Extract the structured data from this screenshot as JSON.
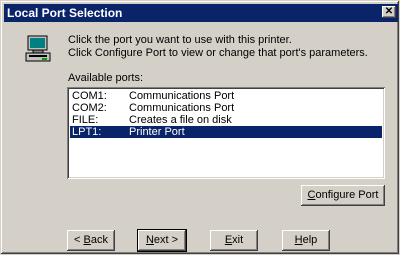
{
  "window": {
    "title": "Local Port Selection",
    "close_glyph": "✕"
  },
  "instructions": {
    "line1": "Click the port you want to use with this printer.",
    "line2": "Click Configure Port to view or change that port's parameters."
  },
  "ports_label": "Available ports:",
  "ports": [
    {
      "port": "COM1:",
      "description": "Communications Port",
      "selected": false
    },
    {
      "port": "COM2:",
      "description": "Communications Port",
      "selected": false
    },
    {
      "port": "FILE:",
      "description": "Creates a file on disk",
      "selected": false
    },
    {
      "port": "LPT1:",
      "description": "Printer Port",
      "selected": true
    }
  ],
  "buttons": {
    "configure": {
      "mnemonic": "C",
      "rest": "onfigure Port"
    },
    "back": {
      "prefix": "< ",
      "mnemonic": "B",
      "rest": "ack"
    },
    "next": {
      "mnemonic": "N",
      "rest": "ext >"
    },
    "exit": {
      "mnemonic": "E",
      "rest": "xit"
    },
    "help": {
      "mnemonic": "H",
      "rest": "elp"
    }
  },
  "icons": {
    "printer": "printer-computer-icon"
  },
  "colors": {
    "titlebar": "#0a246a",
    "face": "#d4d0c8",
    "selection": "#0a246a"
  }
}
